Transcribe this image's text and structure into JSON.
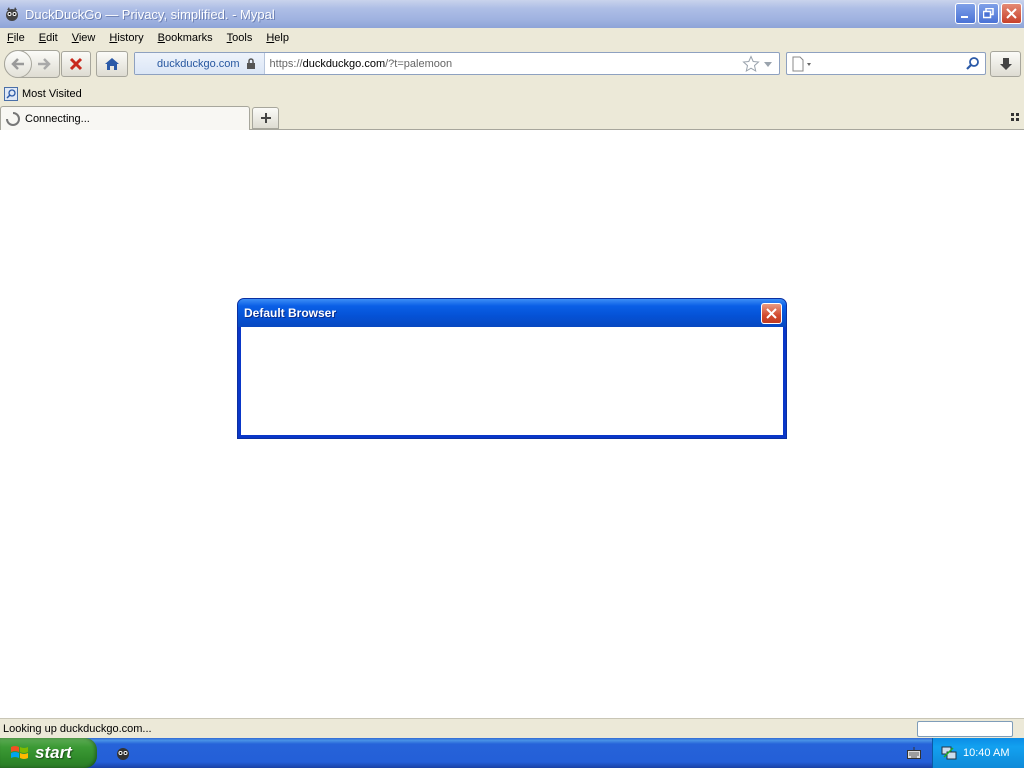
{
  "window": {
    "title": "DuckDuckGo — Privacy, simplified. - Mypal"
  },
  "menu": {
    "items": [
      {
        "label": "File",
        "underline": "F",
        "rest": "ile"
      },
      {
        "label": "Edit",
        "underline": "E",
        "rest": "dit"
      },
      {
        "label": "View",
        "underline": "V",
        "rest": "iew"
      },
      {
        "label": "History",
        "underline": "H",
        "rest": "istory"
      },
      {
        "label": "Bookmarks",
        "underline": "B",
        "rest": "ookmarks"
      },
      {
        "label": "Tools",
        "underline": "T",
        "rest": "ools"
      },
      {
        "label": "Help",
        "underline": "H",
        "rest": "elp"
      }
    ]
  },
  "navbar": {
    "identity_label": "duckduckgo.com",
    "url_scheme": "https://",
    "url_host": "duckduckgo.com",
    "url_path": "/?t=palemoon",
    "search_value": ""
  },
  "bookmarks": {
    "most_visited": "Most Visited"
  },
  "tabs": {
    "active_label": "Connecting..."
  },
  "dialog": {
    "title": "Default Browser"
  },
  "status": {
    "text": "Looking up duckduckgo.com..."
  },
  "taskbar": {
    "start_label": "start",
    "clock": "10:40 AM"
  }
}
